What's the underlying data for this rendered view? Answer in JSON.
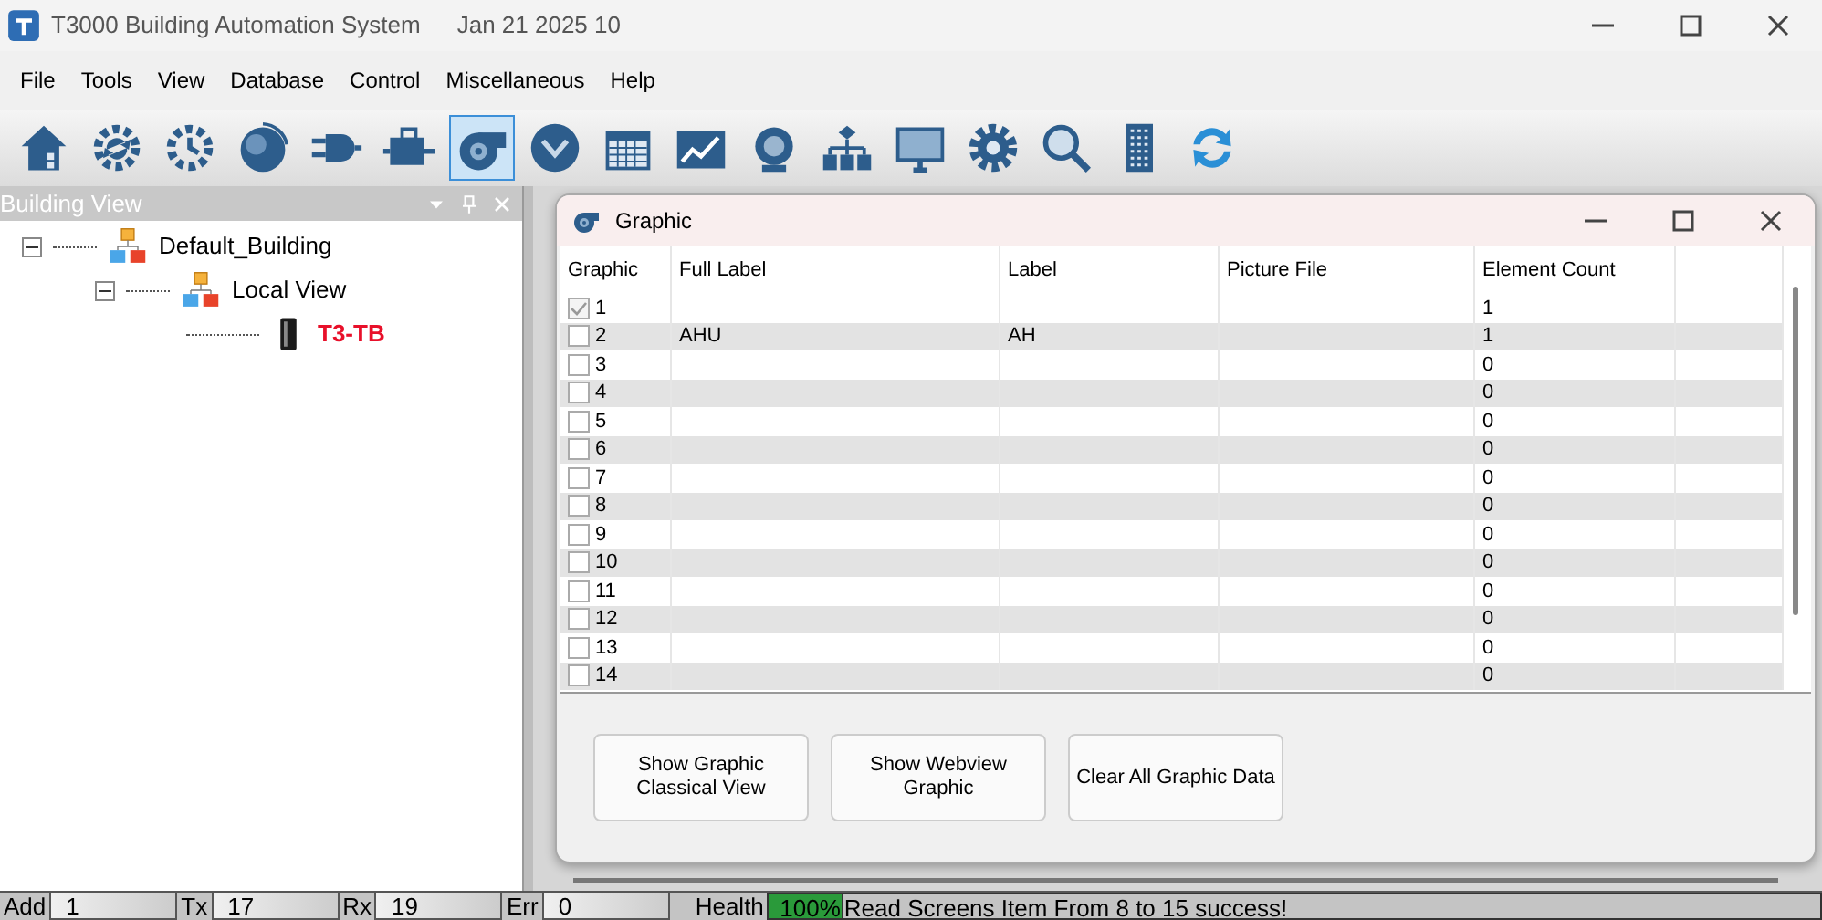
{
  "window": {
    "title": "T3000 Building Automation System",
    "date": "Jan 21 2025 10"
  },
  "menu": [
    "File",
    "Tools",
    "View",
    "Database",
    "Control",
    "Miscellaneous",
    "Help"
  ],
  "toolbar": [
    {
      "selected": false
    },
    {
      "selected": false
    },
    {
      "selected": false
    },
    {
      "selected": false
    },
    {
      "selected": false
    },
    {
      "selected": false
    },
    {
      "selected": true
    },
    {
      "selected": false
    },
    {
      "selected": false
    },
    {
      "selected": false
    },
    {
      "selected": false
    },
    {
      "selected": false
    },
    {
      "selected": false
    },
    {
      "selected": false
    },
    {
      "selected": false
    },
    {
      "selected": false
    },
    {
      "selected": false
    }
  ],
  "building_view": {
    "title": "Building View",
    "tree": [
      {
        "label": "Default_Building",
        "kind": "group",
        "expanded": true,
        "offline": false,
        "children": [
          {
            "label": "Local View",
            "kind": "group",
            "expanded": true,
            "offline": false,
            "children": [
              {
                "label": "T3-TB",
                "kind": "device",
                "offline": true
              }
            ]
          }
        ]
      }
    ]
  },
  "graphic_window": {
    "title": "Graphic",
    "columns": [
      "Graphic",
      "Full Label",
      "Label",
      "Picture File",
      "Element Count"
    ],
    "rows": [
      {
        "number": "1",
        "checked": true,
        "full_label": "",
        "label": "",
        "element_count": "1"
      },
      {
        "number": "2",
        "checked": false,
        "full_label": "AHU",
        "label": "AH",
        "element_count": "1"
      },
      {
        "number": "3",
        "checked": false,
        "element_count": "0"
      },
      {
        "number": "4",
        "checked": false,
        "element_count": "0"
      },
      {
        "number": "5",
        "checked": false,
        "element_count": "0"
      },
      {
        "number": "6",
        "checked": false,
        "element_count": "0"
      },
      {
        "number": "7",
        "checked": false,
        "element_count": "0"
      },
      {
        "number": "8",
        "checked": false,
        "element_count": "0"
      },
      {
        "number": "9",
        "checked": false,
        "element_count": "0"
      },
      {
        "number": "10",
        "checked": false,
        "element_count": "0"
      },
      {
        "number": "11",
        "checked": false,
        "element_count": "0"
      },
      {
        "number": "12",
        "checked": false,
        "element_count": "0"
      },
      {
        "number": "13",
        "checked": false,
        "element_count": "0"
      },
      {
        "number": "14",
        "checked": false,
        "element_count": "0"
      }
    ],
    "buttons": [
      "Show Graphic\nClassical View",
      "Show Webview\nGraphic",
      "Clear All Graphic Data"
    ]
  },
  "status_bar": {
    "fields": [
      {
        "label": "Add",
        "value": "1"
      },
      {
        "label": "Tx",
        "value": "17"
      },
      {
        "label": "Rx",
        "value": "19"
      },
      {
        "label": "Err",
        "value": "0"
      }
    ],
    "health": {
      "label": "Health",
      "reading": "100%",
      "level": 1
    },
    "message": "Read Screens Item From 8 to 15  success!"
  }
}
